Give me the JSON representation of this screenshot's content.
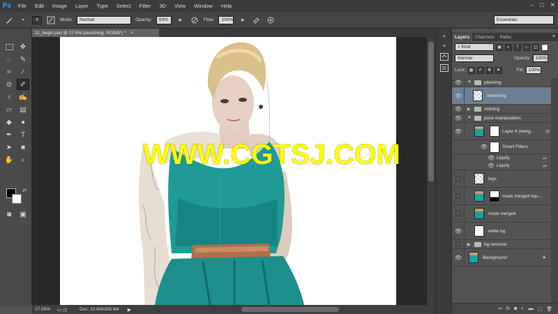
{
  "app": {
    "logo": "Ps"
  },
  "menu": [
    "File",
    "Edit",
    "Image",
    "Layer",
    "Type",
    "Select",
    "Filter",
    "3D",
    "View",
    "Window",
    "Help"
  ],
  "window_controls": [
    "–",
    "□",
    "✕"
  ],
  "options": {
    "brush_size": "4",
    "mode_label": "Mode:",
    "mode_value": "Normal",
    "opacity_label": "Opacity:",
    "opacity_value": "93%",
    "flow_label": "Flow:",
    "flow_value": "100%",
    "workspace": "Essentials"
  },
  "document": {
    "tab_title": "11_begin.psd @ 27.5% (sketching, RGB/8*) *",
    "zoom": "27.55%",
    "doc_size": "Doc: 33.6M/308.6M"
  },
  "watermark": "WWW.CGTSJ.COM",
  "layers_panel": {
    "tabs": [
      "Layers",
      "Channels",
      "Paths"
    ],
    "filter_kind": "Kind",
    "blend_mode": "Normal",
    "opacity_label": "Opacity:",
    "opacity_value": "100%",
    "lock_label": "Lock:",
    "fill_label": "Fill:",
    "fill_value": "100%",
    "layers": [
      {
        "name": "planning",
        "type": "group",
        "expanded": true,
        "visible": true
      },
      {
        "name": "sketching",
        "type": "layer",
        "visible": true,
        "selected": true
      },
      {
        "name": "clothing",
        "type": "group",
        "expanded": false,
        "visible": true
      },
      {
        "name": "pose manipulation",
        "type": "group",
        "expanded": true,
        "visible": true
      },
      {
        "name": "Layer 4 (merg...",
        "type": "smart",
        "visible": true
      },
      {
        "name": "Smart Filters",
        "type": "filter-header",
        "visible": true
      },
      {
        "name": "Liquify",
        "type": "filter",
        "visible": true
      },
      {
        "name": "Liquify",
        "type": "filter",
        "visible": true
      },
      {
        "name": "legs",
        "type": "layer",
        "visible": false
      },
      {
        "name": "mask merged liqu...",
        "type": "masked",
        "visible": false
      },
      {
        "name": "mask merged",
        "type": "layer",
        "visible": false
      },
      {
        "name": "white bg",
        "type": "layer",
        "visible": true
      },
      {
        "name": "bg removal",
        "type": "group",
        "expanded": false,
        "visible": false
      },
      {
        "name": "Background",
        "type": "background",
        "visible": true
      }
    ],
    "footer_icons": [
      "link-icon",
      "fx-icon",
      "mask-icon",
      "adjustment-icon",
      "folder-icon",
      "new-layer-icon",
      "trash-icon"
    ]
  }
}
